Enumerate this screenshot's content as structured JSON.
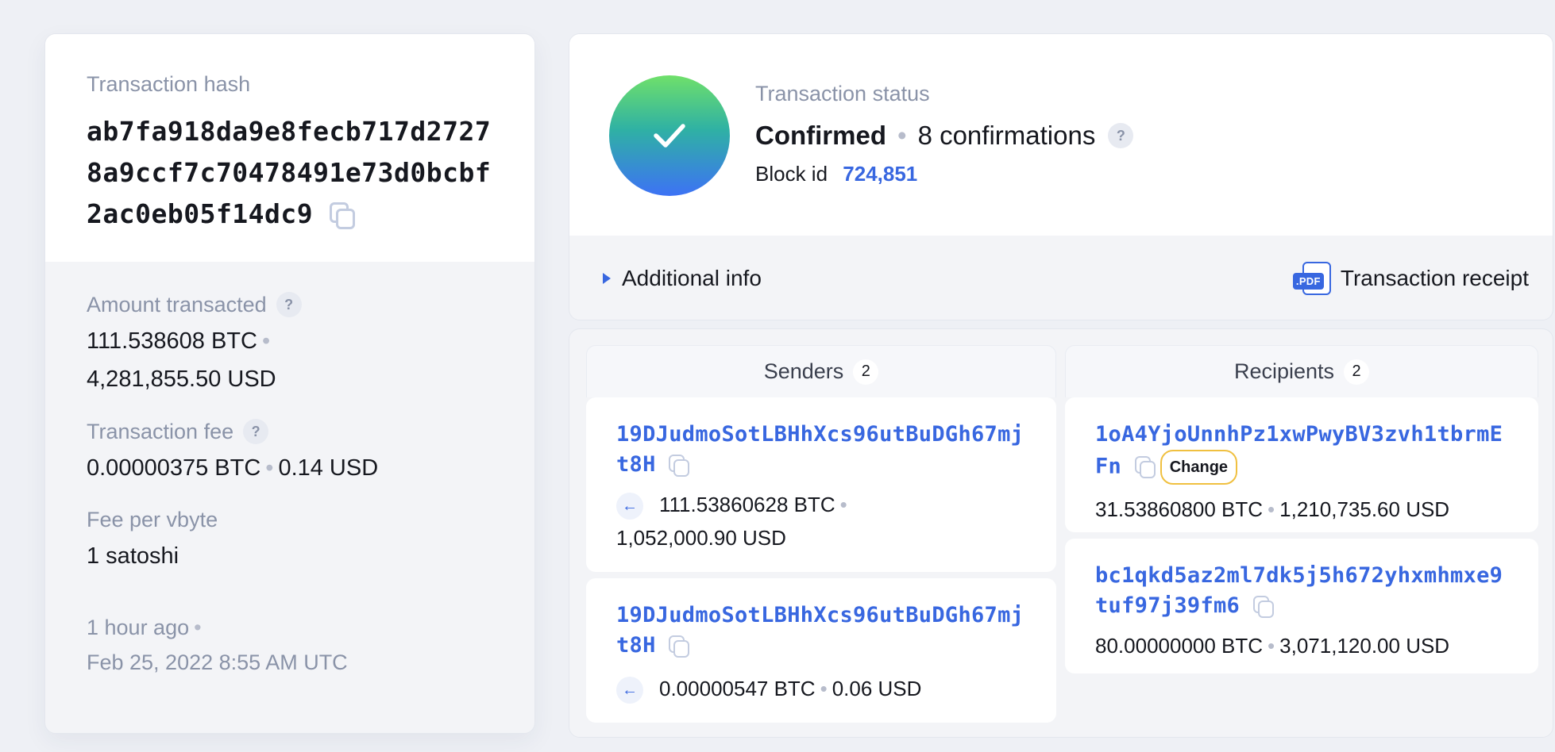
{
  "transaction": {
    "hash_label": "Transaction hash",
    "hash": "ab7fa918da9e8fecb717d27278a9ccf7c70478491e73d0bcbf2ac0eb05f14dc9",
    "amount_label": "Amount transacted",
    "amount_btc": "111.538608 BTC",
    "amount_usd": "4,281,855.50 USD",
    "fee_label": "Transaction fee",
    "fee_btc": "0.00000375 BTC",
    "fee_usd": "0.14 USD",
    "fee_per_vbyte_label": "Fee per vbyte",
    "fee_per_vbyte": "1 satoshi",
    "time_ago": "1 hour ago",
    "timestamp": "Feb 25, 2022 8:55 AM UTC",
    "help_symbol": "?"
  },
  "status": {
    "label": "Transaction status",
    "state": "Confirmed",
    "confirmations": "8 confirmations",
    "block_label": "Block id",
    "block_id": "724,851",
    "additional_info": "Additional info",
    "receipt": "Transaction receipt",
    "pdf_tag": ".PDF"
  },
  "senders": {
    "title": "Senders",
    "count": "2",
    "items": [
      {
        "address": "19DJudmoSotLBHhXcs96utBuDGh67mjt8H",
        "amount_btc": "111.53860628 BTC",
        "amount_usd": "1,052,000.90 USD"
      },
      {
        "address": "19DJudmoSotLBHhXcs96utBuDGh67mjt8H",
        "amount_btc": "0.00000547 BTC",
        "amount_usd": "0.06 USD"
      }
    ]
  },
  "recipients": {
    "title": "Recipients",
    "count": "2",
    "items": [
      {
        "address": "1oA4YjoUnnhPz1xwPwyBV3zvh1tbrmEFn",
        "badge": "Change",
        "amount_btc": "31.53860800 BTC",
        "amount_usd": "1,210,735.60 USD"
      },
      {
        "address": "bc1qkd5az2ml7dk5j5h672yhxmhmxe9tuf97j39fm6",
        "amount_btc": "80.00000000 BTC",
        "amount_usd": "3,071,120.00 USD"
      }
    ]
  },
  "icons": {
    "copy": "copy-icon",
    "check": "check-icon",
    "arrow": "arrow-left-icon",
    "pdf": "pdf-icon",
    "caret": "caret-right-icon"
  },
  "colors": {
    "accent": "#3867e0",
    "muted": "#8a93a8",
    "badge_border": "#f0c040"
  }
}
